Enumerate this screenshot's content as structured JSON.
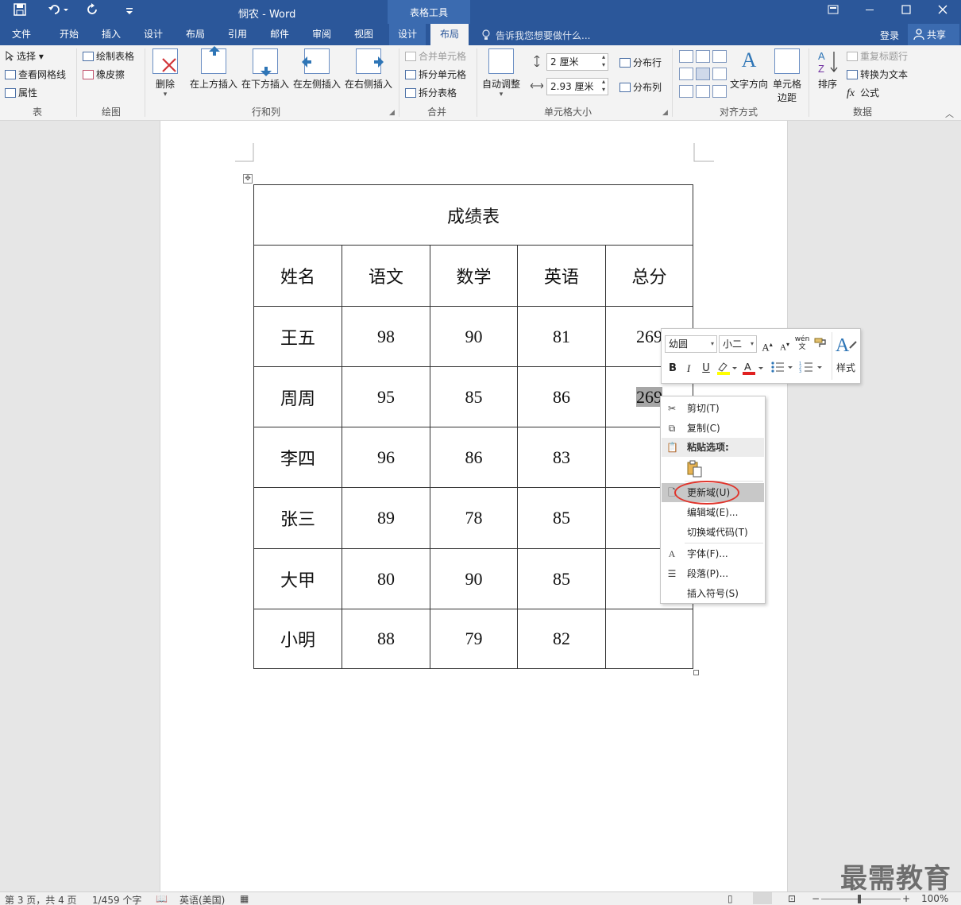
{
  "window": {
    "title": "悯农 - Word",
    "context_tools": "表格工具",
    "signin": "登录",
    "share": "共享"
  },
  "tabs": [
    "文件",
    "开始",
    "插入",
    "设计",
    "布局",
    "引用",
    "邮件",
    "审阅",
    "视图",
    "设计",
    "布局"
  ],
  "tellme": "告诉我您想要做什么...",
  "ribbon": {
    "table": {
      "select": "选择",
      "gridlines": "查看网格线",
      "properties": "属性",
      "label": "表"
    },
    "draw": {
      "draw_table": "绘制表格",
      "eraser": "橡皮擦",
      "label": "绘图"
    },
    "rowscols": {
      "delete": "删除",
      "insert_above": "在上方插入",
      "insert_below": "在下方插入",
      "insert_left": "在左侧插入",
      "insert_right": "在右侧插入",
      "label": "行和列"
    },
    "merge": {
      "merge_cells": "合并单元格",
      "split_cells": "拆分单元格",
      "split_table": "拆分表格",
      "label": "合并"
    },
    "cellsize": {
      "autofit": "自动调整",
      "height": "2 厘米",
      "width": "2.93 厘米",
      "dist_rows": "分布行",
      "dist_cols": "分布列",
      "label": "单元格大小"
    },
    "alignment": {
      "text_direction": "文字方向",
      "cell_margins_1": "单元格",
      "cell_margins_2": "边距",
      "label": "对齐方式"
    },
    "data": {
      "sort": "排序",
      "repeat_header": "重复标题行",
      "convert": "转换为文本",
      "formula": "公式",
      "label": "数据"
    }
  },
  "table": {
    "title": "成绩表",
    "headers": [
      "姓名",
      "语文",
      "数学",
      "英语",
      "总分"
    ],
    "rows": [
      [
        "王五",
        "98",
        "90",
        "81",
        "269"
      ],
      [
        "周周",
        "95",
        "85",
        "86",
        "269"
      ],
      [
        "李四",
        "96",
        "86",
        "83",
        ""
      ],
      [
        "张三",
        "89",
        "78",
        "85",
        ""
      ],
      [
        "大甲",
        "80",
        "90",
        "85",
        ""
      ],
      [
        "小明",
        "88",
        "79",
        "82",
        ""
      ]
    ]
  },
  "minitoolbar": {
    "font": "幼圆",
    "size": "小二",
    "bold": "B",
    "italic": "I",
    "underline": "U",
    "styles": "样式",
    "grow": "A",
    "shrink": "A",
    "phonetic": "wén"
  },
  "contextmenu": {
    "cut": "剪切(T)",
    "copy": "复制(C)",
    "paste_options": "粘贴选项:",
    "update_field": "更新域(U)",
    "edit_field": "编辑域(E)...",
    "toggle_codes": "切换域代码(T)",
    "font": "字体(F)...",
    "paragraph": "段落(P)...",
    "insert_symbol": "插入符号(S)"
  },
  "status": {
    "page": "第 3 页，共 4 页",
    "words": "1/459 个字",
    "language": "英语(美国)",
    "zoom": "100%"
  },
  "watermark": "最需教育"
}
